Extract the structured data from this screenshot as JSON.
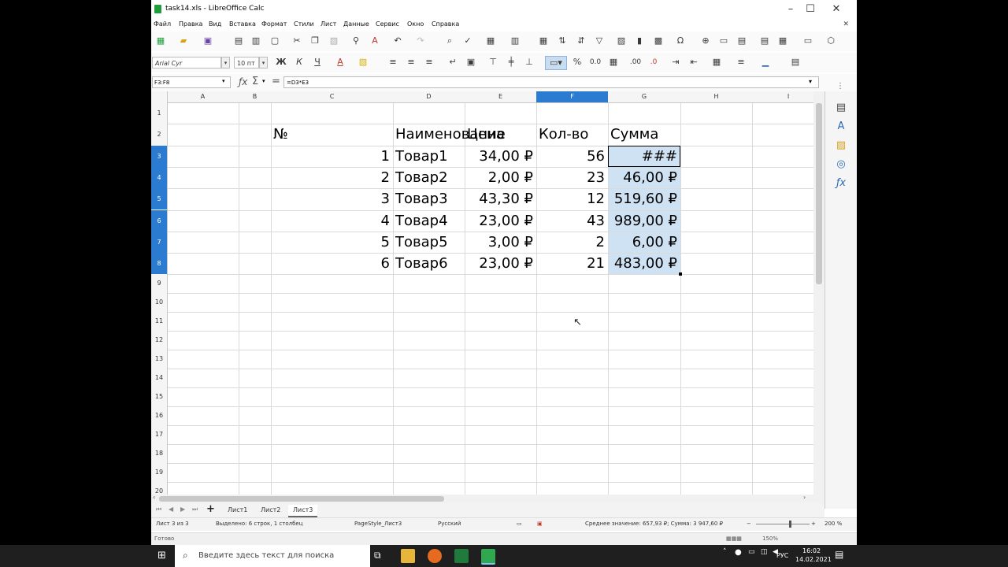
{
  "window": {
    "title": "task14.xls - LibreOffice Calc"
  },
  "menu": [
    "Файл",
    "Правка",
    "Вид",
    "Вставка",
    "Формат",
    "Стили",
    "Лист",
    "Данные",
    "Сервис",
    "Окно",
    "Справка"
  ],
  "toolbar": {
    "font_name": "Arial Cyr",
    "font_size": "10 пт"
  },
  "formula_bar": {
    "cell_ref": "F3:F8",
    "formula": "=D3*E3"
  },
  "columns": [
    "A",
    "B",
    "C",
    "D",
    "E",
    "F",
    "G",
    "H",
    "I"
  ],
  "selected_column": "F",
  "rows": [
    "1",
    "2",
    "3",
    "4",
    "5",
    "6",
    "7",
    "8",
    "9",
    "10",
    "11",
    "12",
    "13",
    "14",
    "15",
    "16",
    "17",
    "18",
    "19",
    "20"
  ],
  "selected_rows": [
    "3",
    "4",
    "5",
    "6",
    "7",
    "8"
  ],
  "table": {
    "headers": [
      "№",
      "Наименование",
      "Цена",
      "Кол-во",
      "Сумма"
    ],
    "rows": [
      {
        "n": "1",
        "name": "Товар1",
        "price": "34,00 ₽",
        "qty": "56",
        "sum": "###"
      },
      {
        "n": "2",
        "name": "Товар2",
        "price": "2,00 ₽",
        "qty": "23",
        "sum": "46,00 ₽"
      },
      {
        "n": "3",
        "name": "Товар3",
        "price": "43,30 ₽",
        "qty": "12",
        "sum": "519,60 ₽"
      },
      {
        "n": "4",
        "name": "Товар4",
        "price": "23,00 ₽",
        "qty": "43",
        "sum": "989,00 ₽"
      },
      {
        "n": "5",
        "name": "Товар5",
        "price": "3,00 ₽",
        "qty": "2",
        "sum": "6,00 ₽"
      },
      {
        "n": "6",
        "name": "Товар6",
        "price": "23,00 ₽",
        "qty": "21",
        "sum": "483,00 ₽"
      }
    ]
  },
  "sheets": [
    {
      "label": "Лист1",
      "active": false
    },
    {
      "label": "Лист2",
      "active": false
    },
    {
      "label": "Лист3",
      "active": true
    }
  ],
  "status": {
    "sheet": "Лист 3 из 3",
    "selection": "Выделено: 6 строк, 1 столбец",
    "page_style": "PageStyle_Лист3",
    "language": "Русский",
    "summary": "Среднее значение: 657,93 ₽; Сумма: 3 947,60 ₽",
    "zoom": "200 %"
  },
  "status2": {
    "ready": "Готово",
    "zoom": "150%"
  },
  "taskbar": {
    "search_placeholder": "Введите здесь текст для поиска",
    "lang": "РУС",
    "time": "16:02",
    "date": "14.02.2021"
  },
  "colors": {
    "selection": "#cfe2f3",
    "header_selected": "#2b7bd1",
    "taskbar": "#1f1f1f"
  }
}
